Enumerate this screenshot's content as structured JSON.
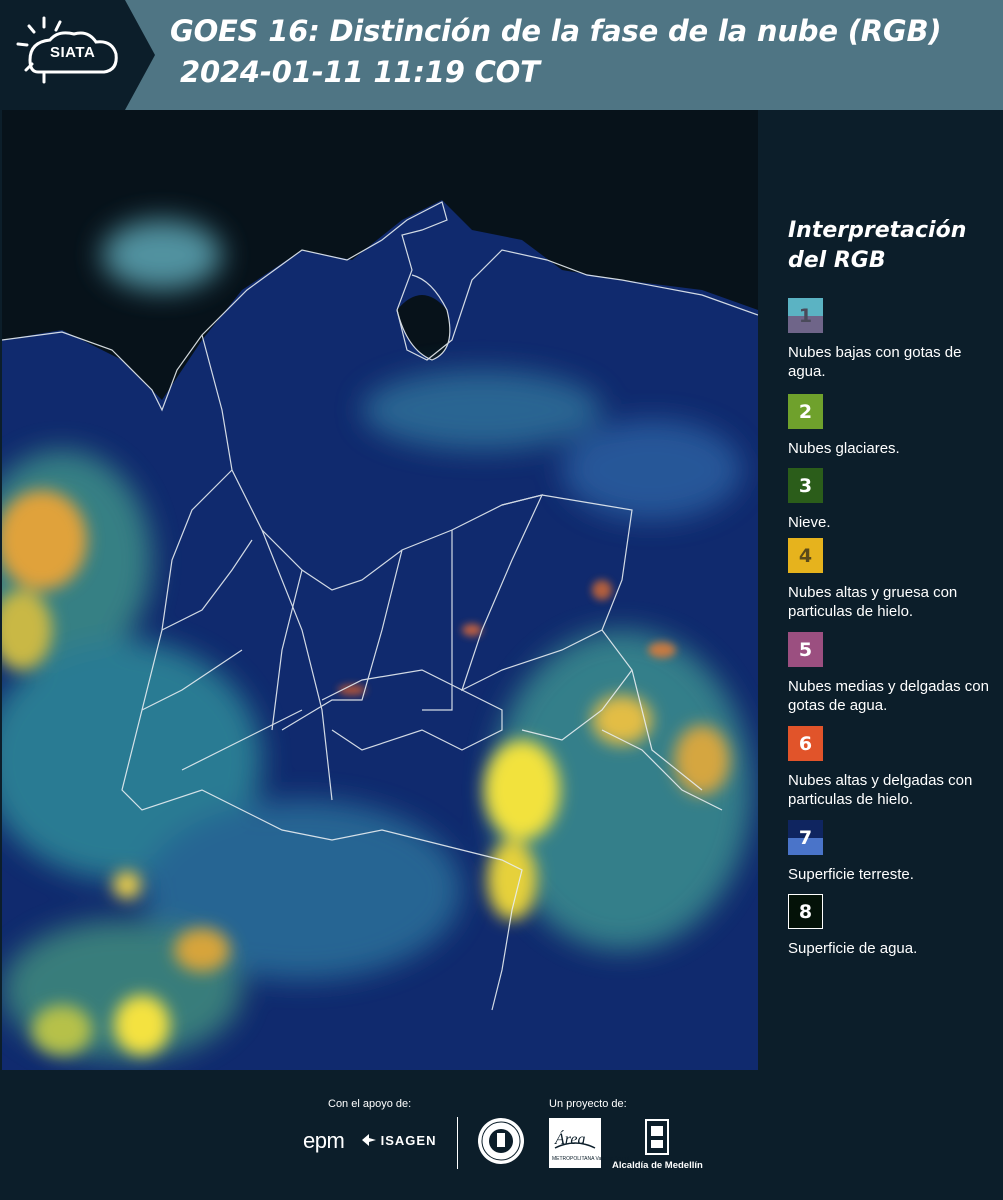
{
  "header": {
    "logo_text": "SIATA",
    "title_line1": "GOES 16: Distinción de la fase de la nube (RGB)",
    "title_line2": "2024-01-11 11:19 COT",
    "bg_color": "#4f7584"
  },
  "legend": {
    "title_line1": "Interpretación",
    "title_line2": "del RGB",
    "items": [
      {
        "num": "1",
        "label": "Nubes bajas con gotas de agua.",
        "color_top": "#5bb3c3",
        "color_bottom": "#6f6589",
        "num_color": "#4a4a5a"
      },
      {
        "num": "2",
        "label": "Nubes glaciares.",
        "color": "#6fa12c"
      },
      {
        "num": "3",
        "label": "Nieve.",
        "color": "#2b5d1a"
      },
      {
        "num": "4",
        "label": "Nubes altas y gruesa con particulas de hielo.",
        "color": "#e6b31d",
        "num_color": "#5a4a1a"
      },
      {
        "num": "5",
        "label": "Nubes medias y delgadas con gotas de agua.",
        "color": "#9b4f80"
      },
      {
        "num": "6",
        "label": "Nubes altas y delgadas con particulas de hielo.",
        "color": "#e1542a"
      },
      {
        "num": "7",
        "label": "Superficie terreste.",
        "color_top": "#0f2560",
        "color_bottom": "#4a74c9"
      },
      {
        "num": "8",
        "label": "Superficie de agua.",
        "color": "#041208",
        "border": "#ffffff"
      }
    ]
  },
  "footer": {
    "support_label": "Con el apoyo de:",
    "project_label": "Un proyecto de:",
    "epm": "epm",
    "isagen": "ISAGEN",
    "area_logo": "Área",
    "area_caption": "METROPOLITANA Valle de Aburrá",
    "alcaldia_label": "Alcaldía de Medellín"
  }
}
